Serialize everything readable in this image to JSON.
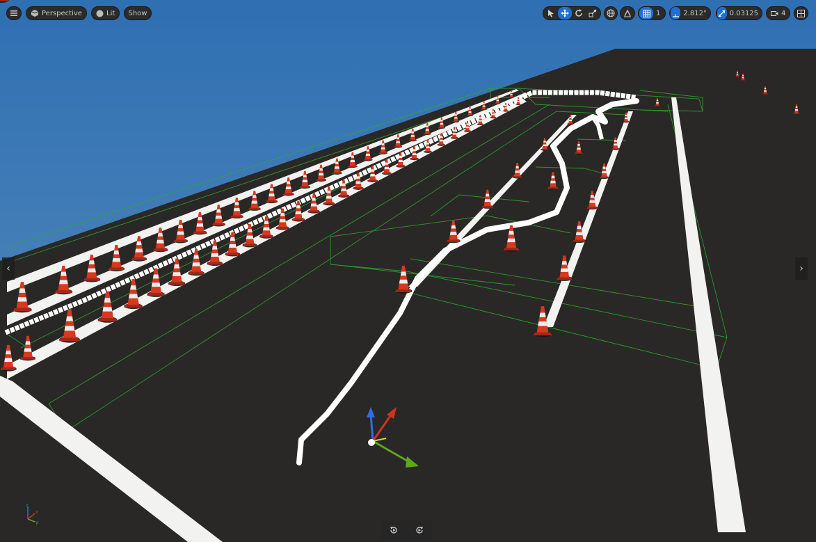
{
  "toolbar": {
    "view_mode_label": "Perspective",
    "lighting_label": "Lit",
    "show_label": "Show",
    "grid_snap_value": "1",
    "rotation_snap_value": "2.812°",
    "scale_snap_value": "0.03125",
    "camera_speed_value": "4"
  },
  "colors": {
    "sky": "#4f86ba",
    "ground": "#2a2826",
    "line": "#f2f2f0",
    "cone": "#d8381f",
    "bounds": "#2faa2f",
    "accent": "#1f6fd6"
  },
  "icons": {
    "menu": "hamburger-icon",
    "perspective": "cube-icon",
    "lit": "sphere-icon",
    "select": "cursor-icon",
    "translate": "move-icon",
    "rotate": "rotate-icon",
    "scale": "scale-icon",
    "world_local": "globe-icon",
    "surface_snap": "surface-snap-icon",
    "grid": "grid-icon",
    "angle": "angle-icon",
    "scale_snap": "scale-arrow-icon",
    "camera": "camera-icon",
    "maximize": "maximize-icon",
    "left": "chevron-left-icon",
    "right": "chevron-right-icon",
    "rewind": "rewind-icon",
    "forward": "forward-icon"
  }
}
